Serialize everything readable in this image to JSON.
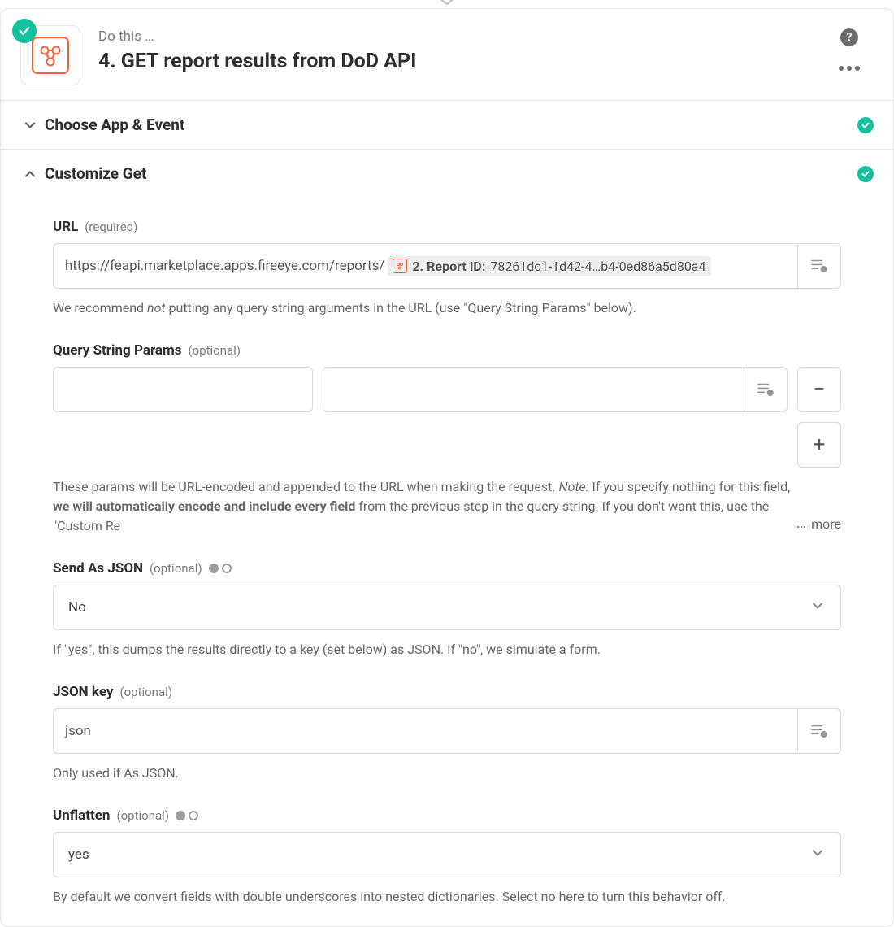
{
  "header": {
    "subtitle": "Do this …",
    "title": "4. GET report results from DoD API"
  },
  "sections": {
    "choose": {
      "label": "Choose App & Event"
    },
    "customize": {
      "label": "Customize Get"
    }
  },
  "url": {
    "label": "URL",
    "req": "(required)",
    "value_prefix": "https://feapi.marketplace.apps.fireeye.com/reports/",
    "pill_label": "2. Report ID:",
    "pill_value": "78261dc1-1d42-4…b4-0ed86a5d80a4",
    "help_pre": "We recommend ",
    "help_em": "not",
    "help_post": " putting any query string arguments in the URL (use \"Query String Params\" below)."
  },
  "qsp": {
    "label": "Query String Params",
    "opt": "(optional)",
    "help_a": "These params will be URL-encoded and appended to the URL when making the request. ",
    "help_note": "Note:",
    "help_b": " If you specify nothing for this field, ",
    "help_bold": "we will automatically encode and include every field",
    "help_c": " from the previous step in the query string. If you don't want this, use the \"Custom Re",
    "more": "more"
  },
  "sendjson": {
    "label": "Send As JSON",
    "opt": "(optional)",
    "value": "No",
    "help": "If \"yes\", this dumps the results directly to a key (set below) as JSON. If \"no\", we simulate a form."
  },
  "jsonkey": {
    "label": "JSON key",
    "opt": "(optional)",
    "value": "json",
    "help": "Only used if As JSON."
  },
  "unflatten": {
    "label": "Unflatten",
    "opt": "(optional)",
    "value": "yes",
    "help": "By default we convert fields with double underscores into nested dictionaries. Select no here to turn this behavior off."
  }
}
